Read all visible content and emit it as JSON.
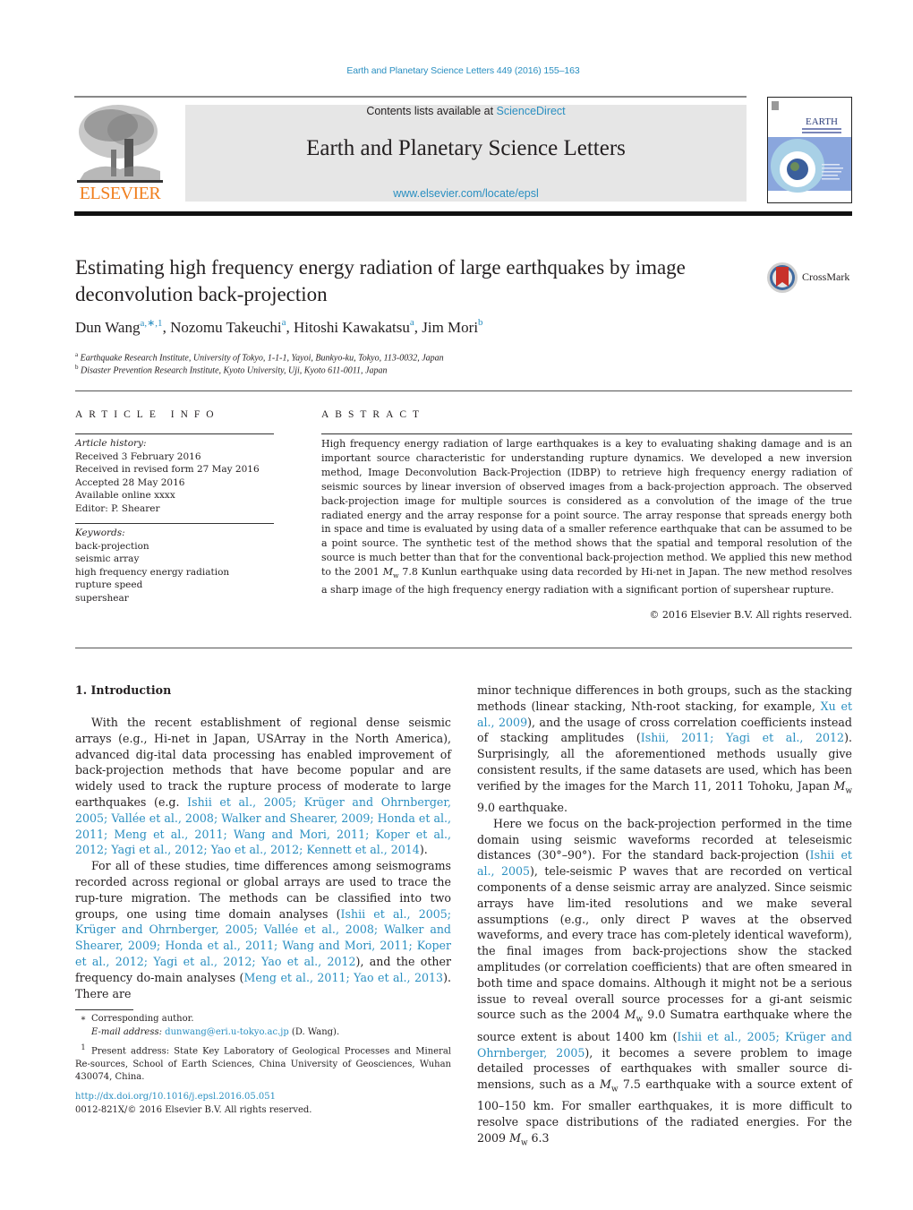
{
  "header": {
    "journal_reference": "Earth and Planetary Science Letters 449 (2016) 155–163",
    "contents_prefix": "Contents lists available at ",
    "contents_link": "ScienceDirect",
    "journal_title": "Earth and Planetary Science Letters",
    "journal_url": "www.elsevier.com/locate/epsl",
    "publisher_logo_text": "ELSEVIER",
    "cover_title": "EARTH",
    "colors": {
      "link": "#2a8fc1",
      "publisher_orange": "#f07f1e",
      "masthead_bg": "#e6e6e6"
    }
  },
  "article": {
    "title": "Estimating high frequency energy radiation of large earthquakes by image deconvolution back-projection",
    "crossmark_label": "CrossMark",
    "authors": [
      {
        "name": "Dun Wang",
        "marks": "a,∗,1"
      },
      {
        "name": "Nozomu Takeuchi",
        "marks": "a"
      },
      {
        "name": "Hitoshi Kawakatsu",
        "marks": "a"
      },
      {
        "name": "Jim Mori",
        "marks": "b"
      }
    ],
    "affiliations": [
      {
        "mark": "a",
        "text": "Earthquake Research Institute, University of Tokyo, 1-1-1, Yayoi, Bunkyo-ku, Tokyo, 113-0032, Japan"
      },
      {
        "mark": "b",
        "text": "Disaster Prevention Research Institute, Kyoto University, Uji, Kyoto 611-0011, Japan"
      }
    ]
  },
  "article_info": {
    "heading": "ARTICLE INFO",
    "history_label": "Article history:",
    "history": [
      "Received 3 February 2016",
      "Received in revised form 27 May 2016",
      "Accepted 28 May 2016",
      "Available online xxxx",
      "Editor: P. Shearer"
    ],
    "keywords_label": "Keywords:",
    "keywords": [
      "back-projection",
      "seismic array",
      "high frequency energy radiation",
      "rupture speed",
      "supershear"
    ]
  },
  "abstract": {
    "heading": "ABSTRACT",
    "text_part1": "High frequency energy radiation of large earthquakes is a key to evaluating shaking damage and is an important source characteristic for understanding rupture dynamics. We developed a new inversion method, Image Deconvolution Back-Projection (IDBP) to retrieve high frequency energy radiation of seismic sources by linear inversion of observed images from a back-projection approach. The observed back-projection image for multiple sources is considered as a convolution of the image of the true radiated energy and the array response for a point source. The array response that spreads energy both in space and time is evaluated by using data of a smaller reference earthquake that can be assumed to be a point source. The synthetic test of the method shows that the spatial and temporal resolution of the source is much better than that for the conventional back-projection method. We applied this new method to the 2001 ",
    "mw": "M",
    "mw_sub": "w",
    "text_part2": " 7.8 Kunlun earthquake using data recorded by Hi-net in Japan. The new method resolves a sharp image of the high frequency energy radiation with a significant portion of supershear rupture.",
    "copyright": "© 2016 Elsevier B.V. All rights reserved."
  },
  "body": {
    "section_heading": "1. Introduction",
    "left_col": {
      "p1_text": "With the recent establishment of regional dense seismic arrays (e.g., Hi-net in Japan, USArray in the North America), advanced dig-ital data processing has enabled improvement of back-projection methods that have become popular and are widely used to track the rupture process of moderate to large earthquakes (e.g. ",
      "p1_refs": "Ishii et al., 2005; Krüger and Ohrnberger, 2005; Vallée et al., 2008; Walker and Shearer, 2009; Honda et al., 2011; Meng et al., 2011; Wang and Mori, 2011; Koper et al., 2012; Yagi et al., 2012; Yao et al., 2012; Kennett et al., 2014",
      "p1_end": ").",
      "p2_text": "For all of these studies, time differences among seismograms recorded across regional or global arrays are used to trace the rup-ture migration. The methods can be classified into two groups, one using time domain analyses (",
      "p2_refs1": "Ishii et al., 2005; Krüger and Ohrnberger, 2005; Vallée et al., 2008; Walker and Shearer, 2009; Honda et al., 2011; Wang and Mori, 2011; Koper et al., 2012; Yagi et al., 2012; Yao et al., 2012",
      "p2_mid": "), and the other frequency do-main analyses (",
      "p2_refs2": "Meng et al., 2011; Yao et al., 2013",
      "p2_end": "). There are"
    },
    "right_col": {
      "p1_text": "minor technique differences in both groups, such as the stacking methods (linear stacking, Nth-root stacking, for example, ",
      "p1_ref1": "Xu et al., 2009",
      "p1_mid": "), and the usage of cross correlation coefficients instead of stacking amplitudes (",
      "p1_ref2": "Ishii, 2011; Yagi et al., 2012",
      "p1_end": "). Surprisingly, all the aforementioned methods usually give consistent results, if the same datasets are used, which has been verified by the images for the March 11, 2011 Tohoku, Japan ",
      "p1_tail": " 9.0 earthquake.",
      "p2_text": "Here we focus on the back-projection performed in the time domain using seismic waveforms recorded at teleseismic distances (30°–90°). For the standard back-projection (",
      "p2_ref1": "Ishii et al., 2005",
      "p2_mid": "), tele-seismic P waves that are recorded on vertical components of a dense seismic array are analyzed. Since seismic arrays have lim-ited resolutions and we make several assumptions (e.g., only direct P waves at the observed waveforms, and every trace has com-pletely identical waveform), the final images from back-projections show the stacked amplitudes (or correlation coefficients) that are often smeared in both time and space domains. Although it might not be a serious issue to reveal overall source processes for a gi-ant seismic source such as the 2004 ",
      "p2_mid2": " 9.0 Sumatra earthquake where the source extent is about 1400 km (",
      "p2_ref2": "Ishii et al., 2005; Krüger and Ohrnberger, 2005",
      "p2_mid3": "), it becomes a severe problem to image detailed processes of earthquakes with smaller source di-mensions, such as a ",
      "p2_mid4": " 7.5 earthquake with a source extent of 100–150 km. For smaller earthquakes, it is more difficult to resolve space distributions of the radiated energies. For the 2009 ",
      "p2_tail": " 6.3"
    }
  },
  "footnotes": {
    "star_mark": "∗",
    "corresponding": "Corresponding author.",
    "email_label": "E-mail address: ",
    "email": "dunwang@eri.u-tokyo.ac.jp",
    "email_suffix": " (D. Wang).",
    "one_mark": "1",
    "present_address": "Present address: State Key Laboratory of Geological Processes and Mineral Re-sources, School of Earth Sciences, China University of Geosciences, Wuhan 430074, China.",
    "doi": "http://dx.doi.org/10.1016/j.epsl.2016.05.051",
    "issn": "0012-821X/© 2016 Elsevier B.V. All rights reserved."
  }
}
